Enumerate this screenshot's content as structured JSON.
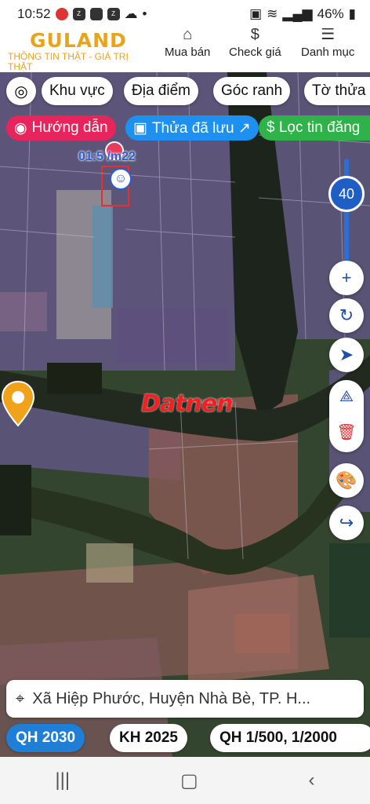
{
  "status_bar": {
    "time": "10:52",
    "battery": "46%"
  },
  "header": {
    "logo_text": "GULAND",
    "tagline": "THÔNG TIN THẬT - GIÁ TRỊ THẬT",
    "nav": [
      {
        "label": "Mua bán",
        "icon": "building-icon"
      },
      {
        "label": "Check giá",
        "icon": "dollar-icon"
      },
      {
        "label": "Danh mục",
        "icon": "menu-icon"
      }
    ]
  },
  "filters": {
    "locate_icon": "crosshair-icon",
    "chips": [
      "Khu vực",
      "Địa điểm",
      "Góc ranh",
      "Tờ thửa"
    ]
  },
  "actions": {
    "guide": "Hướng dẫn",
    "saved": "Thửa đã lưu ↗",
    "filter": "$ Lọc tin đăng"
  },
  "map": {
    "plot_label": "01:5  /m22",
    "watermark": "Datnen",
    "zoom_level": "40"
  },
  "address": "Xã Hiệp Phước, Huyện Nhà Bè, TP. H...",
  "plans": [
    "QH 2030",
    "KH 2025",
    "QH 1/500, 1/2000"
  ],
  "colors": {
    "brand": "#e8a41c",
    "active_plan": "#1f7fd6",
    "guide": "#e8245c",
    "saved": "#1e90f0",
    "filter": "#2fb24a"
  }
}
